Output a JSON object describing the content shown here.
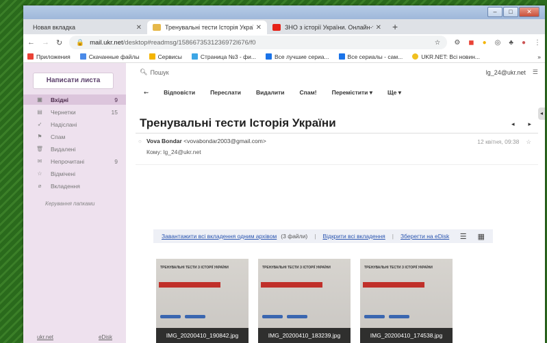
{
  "browser": {
    "tabs": [
      {
        "title": "Новая вкладка",
        "close": "✕",
        "favicon_color": "#dee1e6"
      },
      {
        "title": "Тренувальні тести Історія Украї",
        "close": "✕",
        "favicon_color": "#e6b84a"
      },
      {
        "title": "ЗНО з історії України. Онлайн-т",
        "close": "✕",
        "favicon_color": "#e62117"
      }
    ],
    "new_tab": "+",
    "url_host": "mail.ukr.net",
    "url_path": "/desktop#readmsg/1586673531236972l676/f0",
    "bookmarks": [
      {
        "label": "Приложения",
        "color": "#e94235"
      },
      {
        "label": "Скачанные файлы",
        "color": "#4a8ae8"
      },
      {
        "label": "Сервисы",
        "color": "#f4b400"
      },
      {
        "label": "Страница №3 - фи...",
        "color": "#3da6e5"
      },
      {
        "label": "Все лучшие сериа...",
        "color": "#1a73e8"
      },
      {
        "label": "Все сериалы - сам...",
        "color": "#1a73e8"
      },
      {
        "label": "UKR.NET: Всі новин...",
        "color": "#f0c020"
      }
    ],
    "more_bookmarks": "»"
  },
  "sidebar": {
    "compose": "Написати листа",
    "folders": [
      {
        "label": "Вхідні",
        "count": "9",
        "icon": "inbox-icon",
        "glyph": "▣",
        "active": true
      },
      {
        "label": "Чернетки",
        "count": "15",
        "icon": "drafts-icon",
        "glyph": "▤",
        "active": false
      },
      {
        "label": "Надіслані",
        "count": "",
        "icon": "sent-icon",
        "glyph": "➶",
        "active": false
      },
      {
        "label": "Спам",
        "count": "",
        "icon": "spam-icon",
        "glyph": "⚑",
        "active": false
      },
      {
        "label": "Видалені",
        "count": "",
        "icon": "trash-icon",
        "glyph": "🗑",
        "active": false
      },
      {
        "label": "Непрочитані",
        "count": "9",
        "icon": "unread-icon",
        "glyph": "✉",
        "active": false
      },
      {
        "label": "Відмічені",
        "count": "",
        "icon": "star-icon",
        "glyph": "☆",
        "active": false
      },
      {
        "label": "Вкладення",
        "count": "",
        "icon": "attachment-icon",
        "glyph": "⌀",
        "active": false
      }
    ],
    "manage": "Керування папками",
    "footer": {
      "left": "ukr.net",
      "right": "eDisk"
    }
  },
  "main": {
    "search_placeholder": "Пошук",
    "user": "lg_24@ukr.net",
    "toolbar": {
      "reply": "Відповісти",
      "forward": "Переслати",
      "delete": "Видалити",
      "spam": "Спам!",
      "move": "Перемістити ▾",
      "more": "Ще ▾"
    },
    "subject": "Тренувальні тести Історія України",
    "sender_name": "Vova Bondar",
    "sender_email": "<vovabondar2003@gmail.com>",
    "to_label": "Кому:",
    "to": "lg_24@ukr.net",
    "date": "12 квітня, 09:38",
    "attachments_bar": {
      "download_all": "Завантажити всі вкладення одним архівом",
      "count": "(3 файли)",
      "open_all": "Відкрити всі вкладення",
      "save_edisk": "Зберегти на eDisk"
    },
    "attachments": [
      {
        "name": "IMG_20200410_190842.jpg",
        "header": "ТРЕНУВАЛЬНІ ТЕСТИ З ІСТОРІЇ УКРАЇНИ"
      },
      {
        "name": "IMG_20200410_183239.jpg",
        "header": "ТРЕНУВАЛЬНІ ТЕСТИ З ІСТОРІЇ УКРАЇНИ"
      },
      {
        "name": "IMG_20200410_174538.jpg",
        "header": "ТРЕНУВАЛЬНІ ТЕСТИ З ІСТОРІЇ УКРАЇНИ"
      }
    ]
  }
}
